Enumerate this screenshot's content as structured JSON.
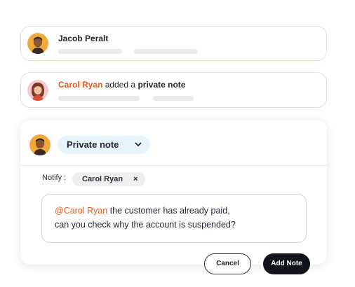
{
  "activity": [
    {
      "name": "Jacob Peralt",
      "avatar_icon": "avatar-jacob-icon"
    },
    {
      "name": "Carol Ryan",
      "action_text": "added a",
      "action_object": "private note",
      "avatar_icon": "avatar-carol-icon"
    }
  ],
  "composer": {
    "note_type": "Private note",
    "notify_label": "Notify :",
    "mention_chip": "Carol Ryan",
    "chip_close": "×",
    "message_mention": "@Carol Ryan",
    "message_line1": " the customer has already paid,",
    "message_line2": "can you check why the account is suspended?",
    "cancel_label": "Cancel",
    "add_note_label": "Add Note"
  },
  "colors": {
    "accent": "#e8591a",
    "card_border": "#f6d9cb",
    "select_bg": "#e8f4fb",
    "primary_button": "#11141a"
  }
}
